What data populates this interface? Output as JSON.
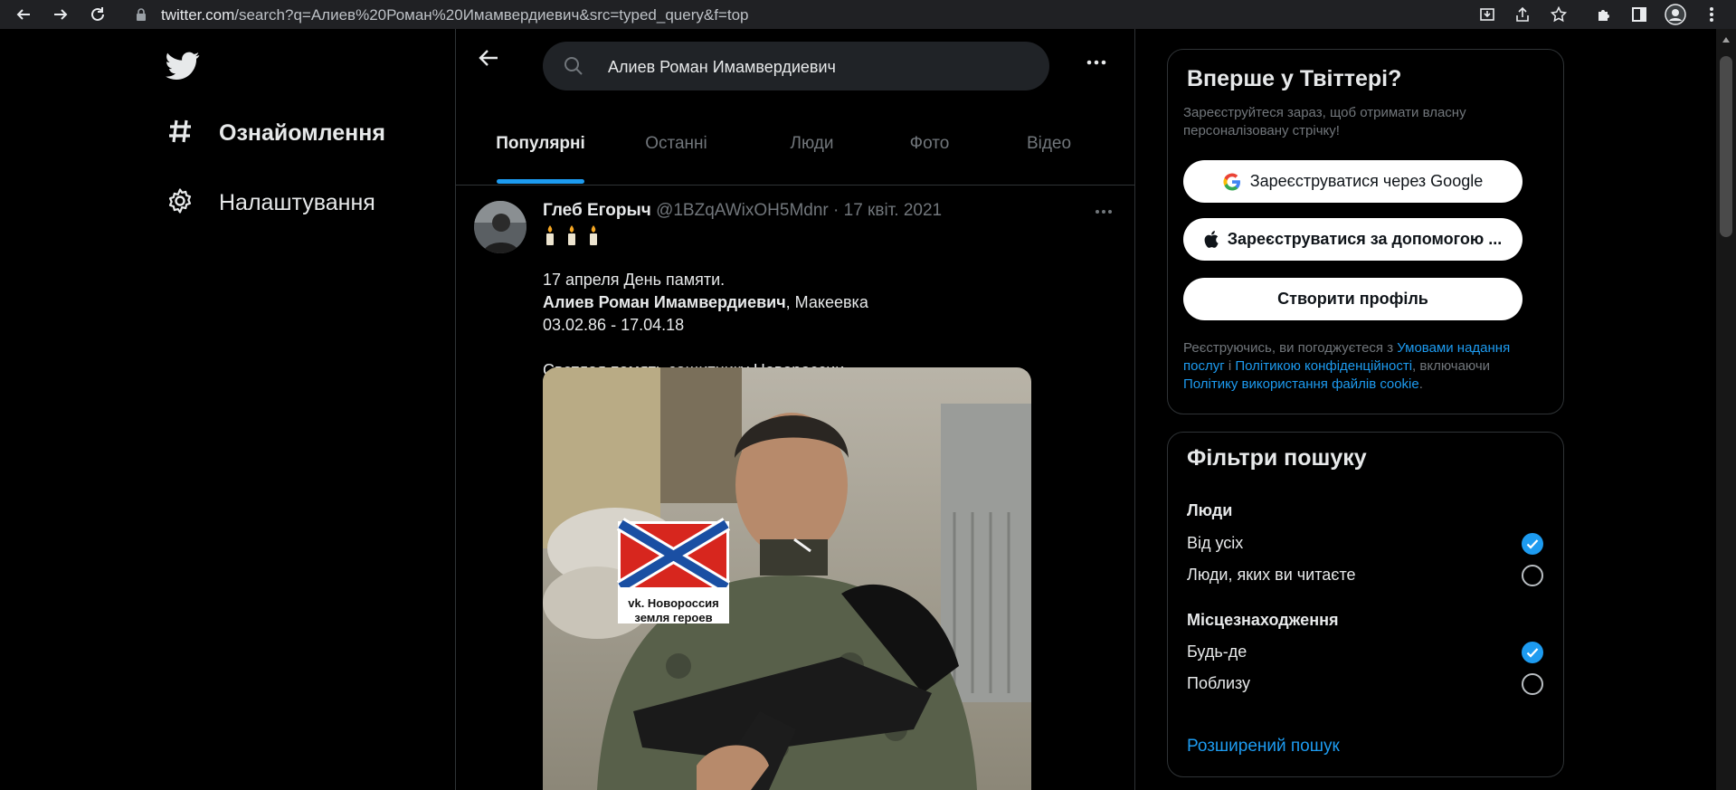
{
  "browser": {
    "url_host": "twitter.com",
    "url_rest": "/search?q=Алиев%20Роман%20Имамвердиевич&src=typed_query&f=top"
  },
  "nav": {
    "items": [
      {
        "label": "Ознайомлення",
        "icon": "hashtag-icon"
      },
      {
        "label": "Налаштування",
        "icon": "settings-gear-icon"
      }
    ]
  },
  "search": {
    "query": "Алиев Роман Имамвердиевич"
  },
  "tabs": [
    {
      "label": "Популярні",
      "active": true
    },
    {
      "label": "Останні",
      "active": false
    },
    {
      "label": "Люди",
      "active": false
    },
    {
      "label": "Фото",
      "active": false
    },
    {
      "label": "Відео",
      "active": false
    }
  ],
  "tweet": {
    "author_name": "Глеб Егорыч",
    "author_handle": "@1BZqAWixOH5Mdnr",
    "separator": "·",
    "date": "17 квіт. 2021",
    "candles": "🕯🕯🕯",
    "lines": {
      "line1": "17 апреля День памяти.",
      "line2_bold": "Алиев Роман Имамвердиевич",
      "line2_rest": ", Макеевка",
      "line3": "03.02.86 - 17.04.18",
      "line4": "Светлая память защитнику Новороссии."
    },
    "photo_caption_line1": "vk. Новороссия",
    "photo_caption_line2": "земля героев"
  },
  "signup": {
    "title": "Вперше у Твіттері?",
    "subtitle": "Зареєструйтеся зараз, щоб отримати власну персоналізовану стрічку!",
    "google_button": "Зареєструватися через Google",
    "apple_button": "Зареєструватися за допомогою ...",
    "create_button": "Створити профіль",
    "terms_prefix": "Реєструючись, ви погоджуєтеся з ",
    "terms_link1": "Умовами надання послуг",
    "terms_mid": " і ",
    "terms_link2": "Політикою конфіденційності",
    "terms_mid2": ", включаючи ",
    "terms_link3": "Політику використання файлів cookie",
    "terms_end": "."
  },
  "filters": {
    "title": "Фільтри пошуку",
    "people_heading": "Люди",
    "people_options": [
      {
        "label": "Від усіх",
        "checked": true
      },
      {
        "label": "Люди, яких ви читаєте",
        "checked": false
      }
    ],
    "location_heading": "Місцезнаходження",
    "location_options": [
      {
        "label": "Будь-де",
        "checked": true
      },
      {
        "label": "Поблизу",
        "checked": false
      }
    ],
    "advanced_link": "Розширений пошук"
  },
  "colors": {
    "accent": "#1d9bf0",
    "background": "#000000",
    "border": "#2f3336",
    "muted_text": "#71767b"
  }
}
